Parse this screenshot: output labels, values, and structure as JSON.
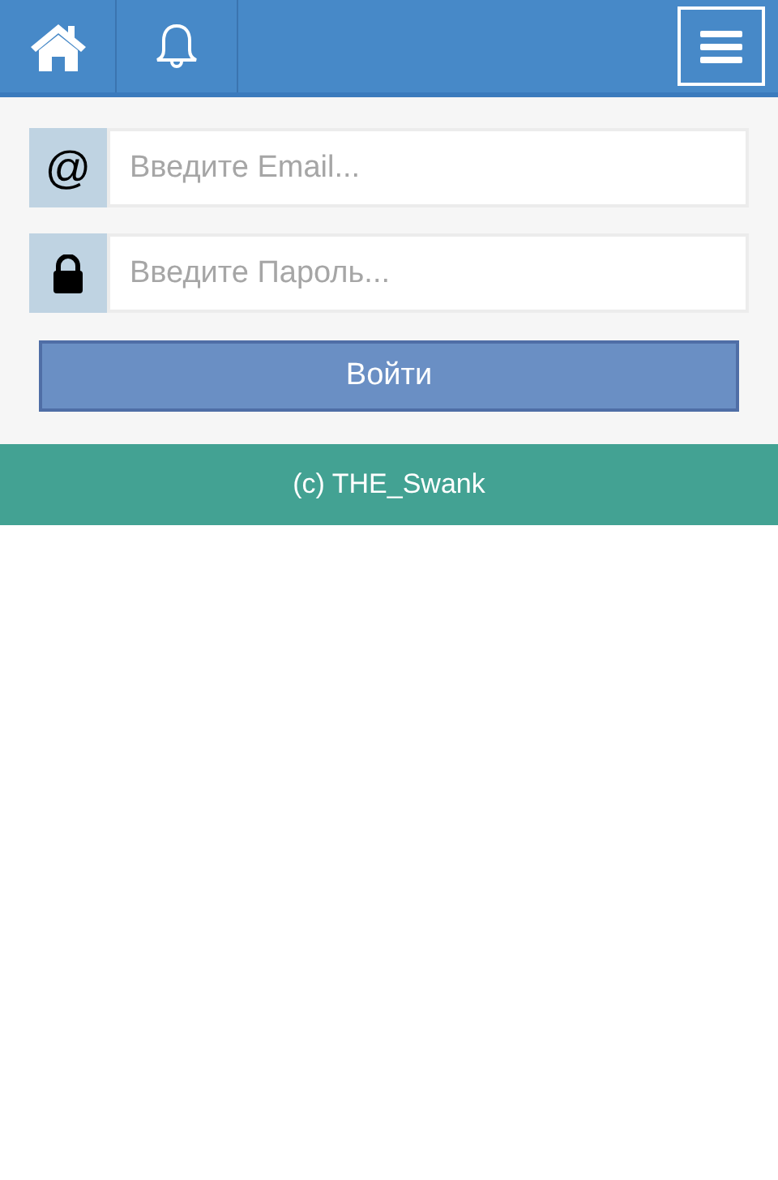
{
  "fields": [
    {
      "kind": "email",
      "addon": "@",
      "placeholder": "Введите Email..."
    },
    {
      "kind": "password",
      "placeholder": "Введите Пароль..."
    }
  ],
  "submit": {
    "label": "Войти"
  },
  "footer": {
    "text": "(c) THE_Swank"
  }
}
